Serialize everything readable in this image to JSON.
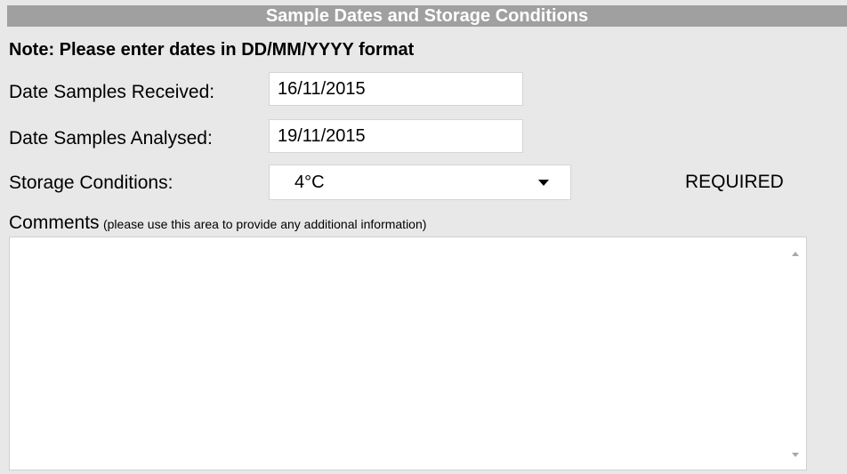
{
  "section": {
    "title": "Sample Dates and Storage Conditions",
    "note": "Note: Please enter dates in DD/MM/YYYY format"
  },
  "fields": {
    "received": {
      "label": "Date Samples Received:",
      "value": "16/11/2015"
    },
    "analysed": {
      "label": "Date Samples Analysed:",
      "value": "19/11/2015"
    },
    "storage": {
      "label": "Storage Conditions:",
      "value": "4°C",
      "required": "REQUIRED"
    }
  },
  "comments": {
    "label": "Comments",
    "hint": "(please use this area to provide any additional information)",
    "value": ""
  },
  "colors": {
    "header_bg": "#a0a0a0",
    "page_bg": "#e8e8e8",
    "header_text": "#ffffff"
  },
  "icons": {
    "dropdown": "chevron-down-icon",
    "scroll_up": "scroll-up-arrow-icon",
    "scroll_down": "scroll-down-arrow-icon"
  }
}
